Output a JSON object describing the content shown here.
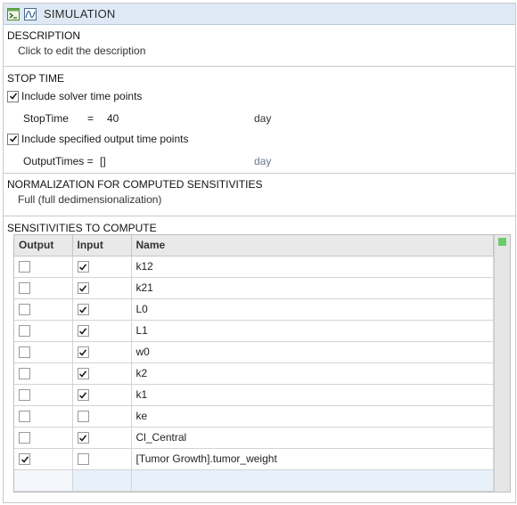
{
  "titlebar": {
    "title": "SIMULATION"
  },
  "description": {
    "heading": "DESCRIPTION",
    "text": "Click to edit the description"
  },
  "stop_time": {
    "heading": "STOP TIME",
    "include_solver": {
      "label": "Include solver time points",
      "checked": true
    },
    "stop_time_label": "StopTime",
    "stop_time_eq": "=",
    "stop_time_value": "40",
    "stop_time_unit": "day",
    "include_output": {
      "label": "Include specified output time points",
      "checked": true
    },
    "output_times_label": "OutputTimes =",
    "output_times_value": "[]",
    "output_times_unit": "day"
  },
  "normalization": {
    "heading": "NORMALIZATION FOR COMPUTED SENSITIVITIES",
    "value": "Full (full dedimensionalization)"
  },
  "sensitivities": {
    "heading": "SENSITIVITIES TO COMPUTE",
    "columns": [
      "Output",
      "Input",
      "Name"
    ],
    "rows": [
      {
        "output": false,
        "input": true,
        "name": "k12"
      },
      {
        "output": false,
        "input": true,
        "name": "k21"
      },
      {
        "output": false,
        "input": true,
        "name": "L0"
      },
      {
        "output": false,
        "input": true,
        "name": "L1"
      },
      {
        "output": false,
        "input": true,
        "name": "w0"
      },
      {
        "output": false,
        "input": true,
        "name": "k2"
      },
      {
        "output": false,
        "input": true,
        "name": "k1"
      },
      {
        "output": false,
        "input": false,
        "name": "ke"
      },
      {
        "output": false,
        "input": true,
        "name": "Cl_Central"
      },
      {
        "output": true,
        "input": false,
        "name": "[Tumor Growth].tumor_weight"
      }
    ]
  },
  "colors": {
    "titlebar_bg": "#dfe9f5",
    "status_indicator": "#6acc6a"
  },
  "icons": [
    "program-icon",
    "plot-icon",
    "checkmark-icon"
  ]
}
